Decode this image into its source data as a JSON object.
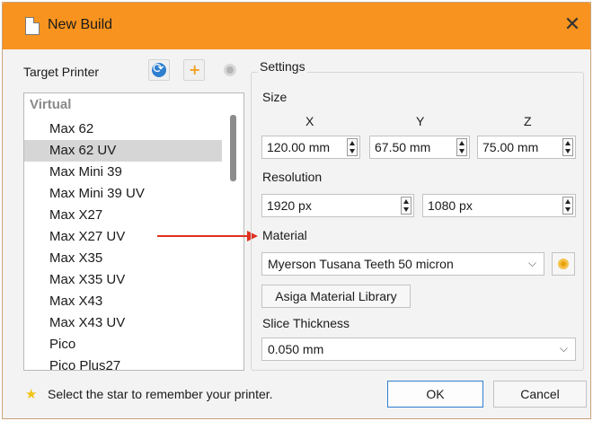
{
  "window": {
    "title": "New Build"
  },
  "left_panel": {
    "label": "Target Printer",
    "group": "Virtual",
    "printers": [
      "Max 62",
      "Max 62 UV",
      "Max Mini 39",
      "Max Mini 39 UV",
      "Max X27",
      "Max X27 UV",
      "Max X35",
      "Max X35 UV",
      "Max X43",
      "Max X43 UV",
      "Pico",
      "Pico Plus27"
    ],
    "selected": "Max 62 UV"
  },
  "settings": {
    "title": "Settings",
    "size": {
      "label": "Size",
      "x_label": "X",
      "y_label": "Y",
      "z_label": "Z",
      "x_value": "120.00 mm",
      "y_value": "67.50 mm",
      "z_value": "75.00 mm"
    },
    "resolution": {
      "label": "Resolution",
      "w_value": "1920 px",
      "h_value": "1080 px"
    },
    "material": {
      "label": "Material",
      "selected": "Myerson Tusana Teeth 50 micron",
      "library_button": "Asiga Material Library"
    },
    "slice": {
      "label": "Slice Thickness",
      "selected": "0.050 mm"
    }
  },
  "footer": {
    "hint": "Select the star to remember your printer.",
    "ok_label": "OK",
    "cancel_label": "Cancel"
  },
  "colors": {
    "titlebar": "#f7931e",
    "arrow": "#e03020",
    "star": "#f1c40f"
  }
}
